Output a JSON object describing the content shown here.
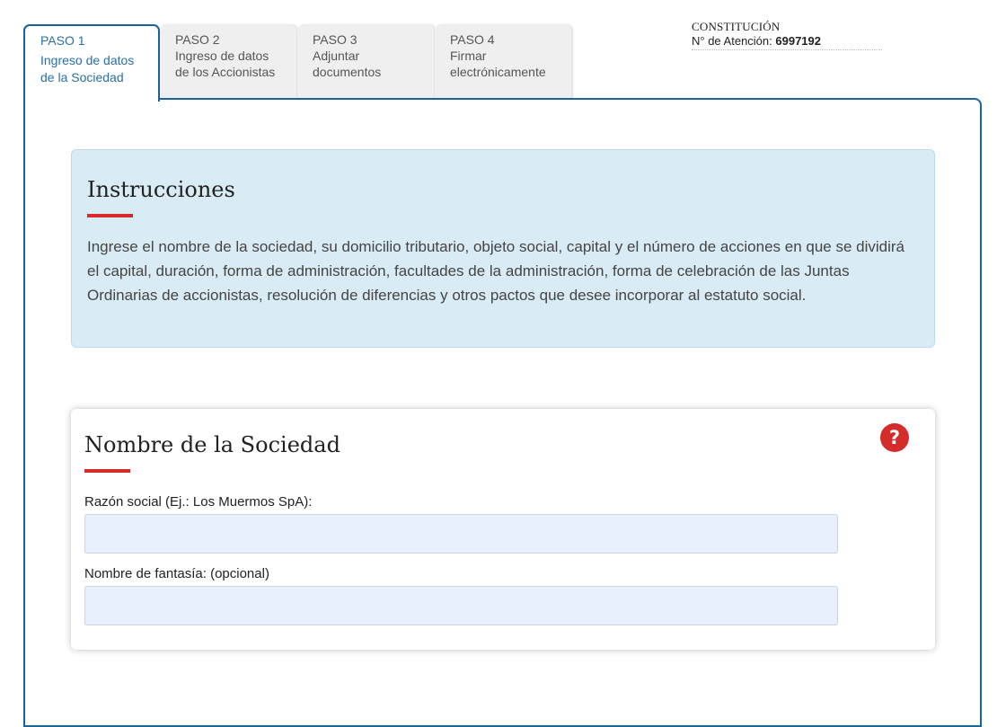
{
  "tabs": [
    {
      "step": "PASO 1",
      "desc": "Ingreso de datos de la Sociedad"
    },
    {
      "step": "PASO 2",
      "desc": "Ingreso de datos de los Accionistas"
    },
    {
      "step": "PASO 3",
      "desc": "Adjuntar documentos"
    },
    {
      "step": "PASO 4",
      "desc": "Firmar electrónicamente"
    }
  ],
  "attention": {
    "title": "CONSTITUCIÓN",
    "label": "N° de Atención:",
    "number": "6997192"
  },
  "instructions": {
    "title": "Instrucciones",
    "text": "Ingrese el nombre de la sociedad, su domicilio tributario, objeto social, capital y el número de acciones en que se dividirá el capital, duración, forma de administración, facultades de la administración, forma de celebración de las Juntas Ordinarias de accionistas, resolución de diferencias y otros pactos que desee incorporar al estatuto social."
  },
  "society_name": {
    "title": "Nombre de la Sociedad",
    "help_icon": "question-icon",
    "help_glyph": "?",
    "razon_social": {
      "label": "Razón social (Ej.: Los Muermos SpA):",
      "value": ""
    },
    "nombre_fantasia": {
      "label": "Nombre de fantasía: (opcional)",
      "value": ""
    }
  },
  "colors": {
    "accent": "#1c6399",
    "red": "#d42b2b",
    "info_bg": "#d9ecf5",
    "input_bg": "#e8effd"
  }
}
